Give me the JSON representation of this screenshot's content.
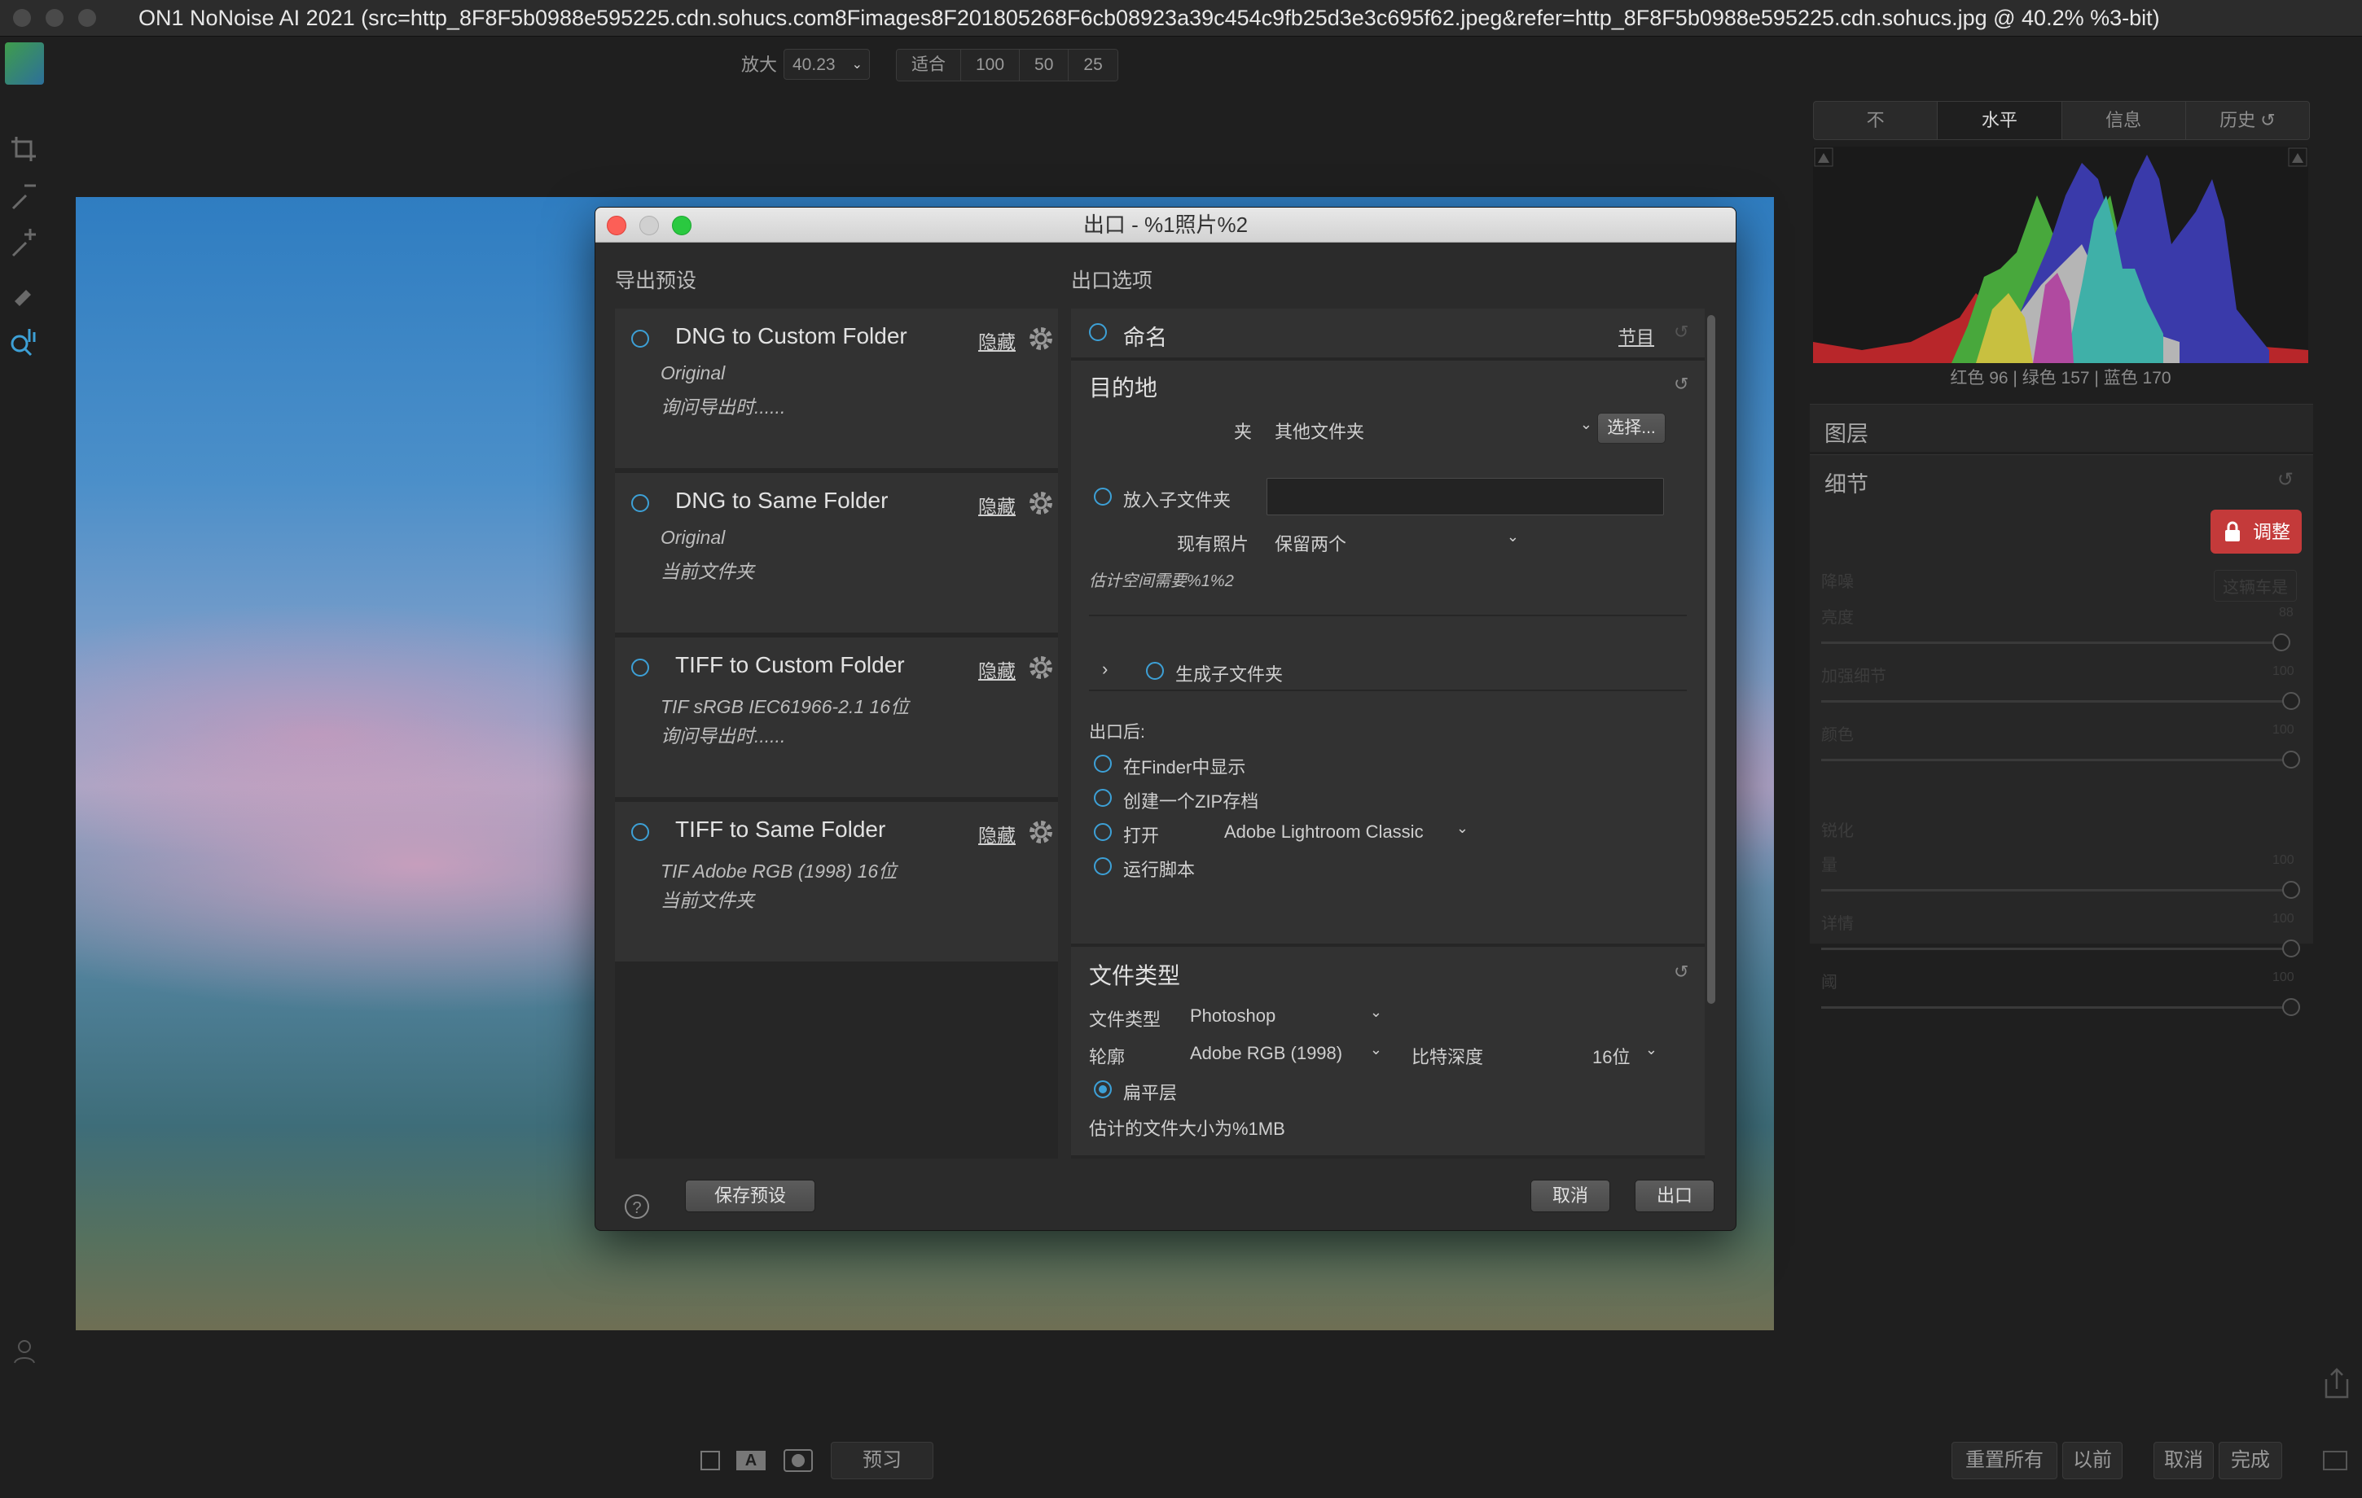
{
  "window": {
    "title": "ON1 NoNoise AI 2021 (src=http_8F8F5b0988e595225.cdn.sohucs.com8Fimages8F201805268F6cb08923a39c454c9fb25d3e3c695f62.jpeg&refer=http_8F8F5b0988e595225.cdn.sohucs.jpg @ 40.2% %3-bit)"
  },
  "toolbar": {
    "zoom_label": "放大",
    "zoom_value": "40.23",
    "zoom_options": [
      "适合",
      "100",
      "50",
      "25"
    ]
  },
  "right_panel": {
    "tabs": [
      "不",
      "水平",
      "信息",
      "历史"
    ],
    "active_tab": "水平",
    "rgb_readout": "红色  96  |  绿色 157  |  蓝色 170",
    "layers_label": "图层",
    "detail_label": "细节",
    "adjust_button": "调整",
    "dim_labels": [
      "降噪",
      "亮度",
      "加强细节",
      "颜色",
      "锐化",
      "量",
      "详情",
      "阈"
    ],
    "dim_pill": "这辆车是",
    "dim_values": [
      "88",
      "100",
      "100",
      "100",
      "100",
      "100"
    ]
  },
  "bottom_bar": {
    "preview_label": "预习",
    "reset_all": "重置所有",
    "previous": "以前",
    "cancel": "取消",
    "done": "完成"
  },
  "dialog": {
    "title": "出口 - %1照片%2",
    "presets_header": "导出预设",
    "options_header": "出口选项",
    "presets": [
      {
        "name": "DNG to Custom Folder",
        "hide": "隐藏",
        "line1": "Original",
        "line2": "询问导出时......"
      },
      {
        "name": "DNG to Same Folder",
        "hide": "隐藏",
        "line1": "Original",
        "line2": "当前文件夹"
      },
      {
        "name": "TIFF to Custom Folder",
        "hide": "隐藏",
        "line1": "TIF  sRGB IEC61966-2.1  16位",
        "line2": "询问导出时......"
      },
      {
        "name": "TIFF to Same Folder",
        "hide": "隐藏",
        "line1": "TIF  Adobe RGB (1998)  16位",
        "line2": "当前文件夹"
      }
    ],
    "naming": {
      "label": "命名",
      "link": "节目"
    },
    "destination": {
      "heading": "目的地",
      "folder_label": "夹",
      "folder_value": "其他文件夹",
      "choose_button": "选择...",
      "subfolder_label": "放入子文件夹",
      "subfolder_value": "",
      "existing_label": "现有照片",
      "existing_value": "保留两个",
      "space_estimate": "估计空间需要%1%2",
      "generate_subfolder": "生成子文件夹"
    },
    "after_export": {
      "heading": "出口后:",
      "show_in_finder": "在Finder中显示",
      "create_zip": "创建一个ZIP存档",
      "open_label": "打开",
      "open_app": "Adobe Lightroom Classic",
      "run_script": "运行脚本"
    },
    "file_type": {
      "heading": "文件类型",
      "type_label": "文件类型",
      "type_value": "Photoshop",
      "profile_label": "轮廓",
      "profile_value": "Adobe RGB (1998)",
      "bitdepth_label": "比特深度",
      "bitdepth_value": "16位",
      "flatten_label": "扁平层",
      "size_estimate": "估计的文件大小为%1MB"
    },
    "save_preset": "保存预设",
    "cancel": "取消",
    "export": "出口",
    "help": "?"
  },
  "colors": {
    "accent": "#3da0d6",
    "adjust_red": "#c43a3a",
    "close_red": "#fc5f57",
    "minimize": "#d0d0d0",
    "zoom_green": "#2ac940"
  }
}
